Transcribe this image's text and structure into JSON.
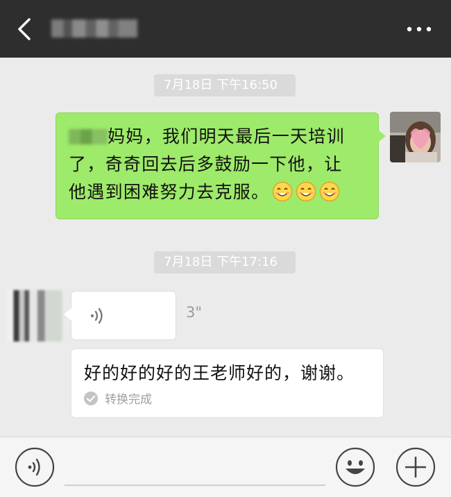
{
  "header": {
    "title_blurred": true
  },
  "messages": [
    {
      "timestamp": "7月18日 下午16:50"
    },
    {
      "sender": "me",
      "text_line1": "妈妈，我们明天最后一天培训",
      "text_line2": "了，奇奇回去后多鼓励一下他，让",
      "text_line3": "他遇到困难努力去克服。"
    },
    {
      "timestamp": "7月18日 下午17:16"
    },
    {
      "sender": "other",
      "voice_duration": "3\"",
      "transcript": "好的好的好的王老师好的，谢谢。",
      "transcript_status": "转换完成"
    }
  ],
  "icons": [
    "back-icon",
    "more-icon",
    "voice-icon",
    "emoji-icon",
    "plus-icon",
    "check-icon",
    "smiley-emoji"
  ],
  "colors": {
    "header_bg": "#2e2e2e",
    "my_bubble": "#9eea6a",
    "chat_bg": "#ebebeb"
  }
}
